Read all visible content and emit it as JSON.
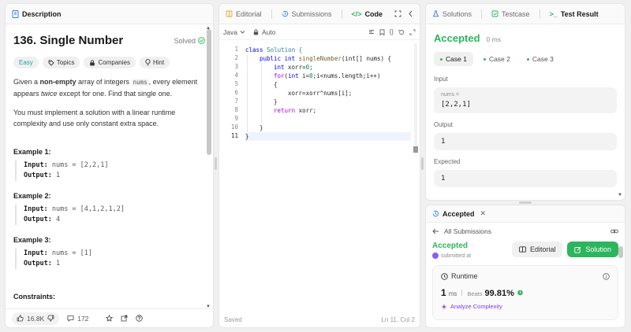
{
  "left": {
    "tab_label": "Description",
    "problem_title": "136. Single Number",
    "solved_label": "Solved",
    "chips": {
      "difficulty": "Easy",
      "topics": "Topics",
      "companies": "Companies",
      "hint": "Hint"
    },
    "desc": {
      "p1_a": "Given a ",
      "p1_bold": "non-empty",
      "p1_b": " array of integers ",
      "p1_code": "nums",
      "p1_c": ", every element appears ",
      "p1_italic": "twice",
      "p1_d": " except for one. Find that single one.",
      "p2": "You must implement a solution with a linear runtime complexity and use only constant extra space."
    },
    "examples": [
      {
        "title": "Example 1:",
        "input_label": "Input:",
        "input": "nums = [2,2,1]",
        "output_label": "Output:",
        "output": "1"
      },
      {
        "title": "Example 2:",
        "input_label": "Input:",
        "input": "nums = [4,1,2,1,2]",
        "output_label": "Output:",
        "output": "4"
      },
      {
        "title": "Example 3:",
        "input_label": "Input:",
        "input": "nums = [1]",
        "output_label": "Output:",
        "output": "1"
      }
    ],
    "constraints_label": "Constraints:",
    "footer": {
      "likes": "16.8K",
      "comments": "172"
    }
  },
  "mid": {
    "tabs": {
      "editorial": "Editorial",
      "submissions": "Submissions",
      "code": "Code"
    },
    "language": "Java",
    "auto_label": "Auto",
    "line_numbers": [
      "1",
      "2",
      "3",
      "4",
      "5",
      "6",
      "7",
      "8",
      "9",
      "10",
      "11"
    ],
    "code": {
      "l1_kw": "class",
      "l1_name": " Solution {",
      "l2_kw1": "public",
      "l2_kw2": " int",
      "l2_fn": " singleNumber",
      "l2_rest": "(int[] nums) {",
      "l3_kw": "int",
      "l3_a": " xorr=",
      "l3_num": "0",
      "l3_b": ";",
      "l4_kw": "for",
      "l4_a": "(",
      "l4_kw2": "int",
      "l4_b": " i=",
      "l4_num": "0",
      "l4_c": ";i<nums.length;i++)",
      "l5": "{",
      "l6": "xorr=xorr^nums[i];",
      "l7": "}",
      "l8_kw": "return",
      "l8_rest": " xorr;",
      "l9": "",
      "l10": "}",
      "l11": "}"
    },
    "status_saved": "Saved",
    "status_pos": "Ln 11, Col 2"
  },
  "rtop": {
    "tabs": {
      "solutions": "Solutions",
      "testcase": "Testcase",
      "result": "Test Result"
    },
    "status": "Accepted",
    "runtime": "0 ms",
    "cases": [
      "Case 1",
      "Case 2",
      "Case 3"
    ],
    "input_label": "Input",
    "input_var": "nums =",
    "input_value": "[2,2,1]",
    "output_label": "Output",
    "output_value": "1",
    "expected_label": "Expected",
    "expected_value": "1"
  },
  "rbot": {
    "tab_label": "Accepted",
    "back_label": "All Submissions",
    "status": "Accepted",
    "submitted_label": "submitted at",
    "editorial_btn": "Editorial",
    "solution_btn": "Solution",
    "runtime_label": "Runtime",
    "runtime_value": "1",
    "runtime_unit": "ms",
    "beats_label": "Beats",
    "beats_value": "99.81%",
    "analyze_label": "Analyze Complexity"
  },
  "colors": {
    "accent_green": "#2db55d",
    "easy_teal": "#1aa6a0",
    "keyword_blue": "#0000ff"
  }
}
